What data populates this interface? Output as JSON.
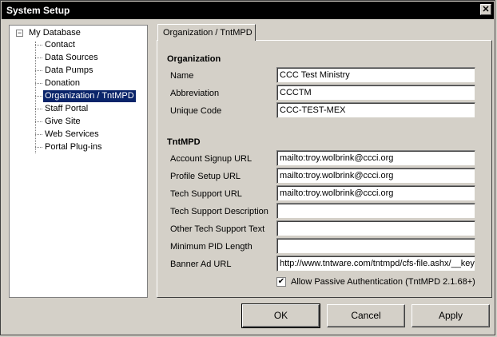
{
  "window": {
    "title": "System Setup",
    "close_glyph": "✕"
  },
  "tree": {
    "root_label": "My Database",
    "expander": "−",
    "items": [
      {
        "label": "Contact"
      },
      {
        "label": "Data Sources"
      },
      {
        "label": "Data Pumps"
      },
      {
        "label": "Donation"
      },
      {
        "label": "Organization / TntMPD"
      },
      {
        "label": "Staff Portal"
      },
      {
        "label": "Give Site"
      },
      {
        "label": "Web Services"
      },
      {
        "label": "Portal Plug-ins"
      }
    ],
    "selected_index": 4
  },
  "tab": {
    "label": "Organization / TntMPD"
  },
  "organization": {
    "section_title": "Organization",
    "name_label": "Name",
    "name_value": "CCC Test Ministry",
    "abbr_label": "Abbreviation",
    "abbr_value": "CCCTM",
    "code_label": "Unique Code",
    "code_value": "CCC-TEST-MEX"
  },
  "tntmpd": {
    "section_title": "TntMPD",
    "account_label": "Account Signup URL",
    "account_value": "mailto:troy.wolbrink@ccci.org",
    "profile_label": "Profile Setup URL",
    "profile_value": "mailto:troy.wolbrink@ccci.org",
    "tech_url_label": "Tech Support URL",
    "tech_url_value": "mailto:troy.wolbrink@ccci.org",
    "tech_desc_label": "Tech Support Description",
    "tech_desc_value": "",
    "other_label": "Other Tech Support Text",
    "other_value": "",
    "pid_label": "Minimum PID Length",
    "pid_value": "",
    "banner_label": "Banner Ad URL",
    "banner_value": "http://www.tntware.com/tntmpd/cfs-file.ashx/__key",
    "passive_label": "Allow Passive Authentication (TntMPD 2.1.68+)",
    "passive_checked": true,
    "check_glyph": "✔"
  },
  "buttons": {
    "ok": "OK",
    "cancel": "Cancel",
    "apply": "Apply"
  }
}
